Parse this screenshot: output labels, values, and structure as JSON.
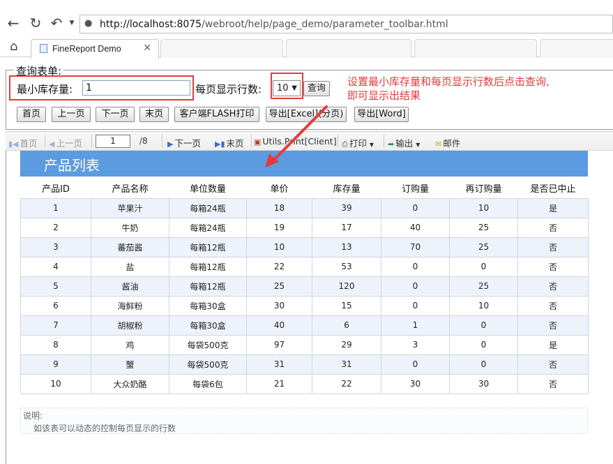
{
  "browser": {
    "url_host": "http://localhost:8075",
    "url_path": "/webroot/help/page_demo/parameter_toolbar.html",
    "tab_title": "FineReport Demo"
  },
  "query_form": {
    "legend": "查询表单:",
    "min_stock_label": "最小库存量:",
    "min_stock_value": "1",
    "rows_label": "每页显示行数:",
    "rows_value": "10",
    "query_button": "查询",
    "buttons": [
      "首页",
      "上一页",
      "下一页",
      "末页",
      "客户端FLASH打印",
      "导出[Excel](分页)",
      "导出[Word]"
    ]
  },
  "annotation": {
    "line1": "设置最小库存量和每页显示行数后点击查询,",
    "line2": "即可显示出结果"
  },
  "toolbar": {
    "first": "首页",
    "prev": "上一页",
    "page_current": "1",
    "page_total": "/8",
    "next": "下一页",
    "last": "末页",
    "print_client": "Utils.Print[Client]",
    "print": "打印",
    "export": "输出",
    "email": "邮件"
  },
  "report": {
    "title": "产品列表",
    "columns": [
      "产品ID",
      "产品名称",
      "单位数量",
      "单价",
      "库存量",
      "订购量",
      "再订购量",
      "是否已中止"
    ],
    "rows": [
      [
        "1",
        "苹果汁",
        "每箱24瓶",
        "18",
        "39",
        "0",
        "10",
        "是"
      ],
      [
        "2",
        "牛奶",
        "每箱24瓶",
        "19",
        "17",
        "40",
        "25",
        "否"
      ],
      [
        "3",
        "蕃茄酱",
        "每箱12瓶",
        "10",
        "13",
        "70",
        "25",
        "否"
      ],
      [
        "4",
        "盐",
        "每箱12瓶",
        "22",
        "53",
        "0",
        "0",
        "否"
      ],
      [
        "5",
        "酱油",
        "每箱12瓶",
        "25",
        "120",
        "0",
        "25",
        "否"
      ],
      [
        "6",
        "海鲜粉",
        "每箱30盒",
        "30",
        "15",
        "0",
        "10",
        "否"
      ],
      [
        "7",
        "胡椒粉",
        "每箱30盒",
        "40",
        "6",
        "1",
        "0",
        "否"
      ],
      [
        "8",
        "鸡",
        "每袋500克",
        "97",
        "29",
        "3",
        "0",
        "是"
      ],
      [
        "9",
        "蟹",
        "每袋500克",
        "31",
        "31",
        "0",
        "0",
        "否"
      ],
      [
        "10",
        "大众奶酪",
        "每袋6包",
        "21",
        "22",
        "30",
        "30",
        "否"
      ]
    ]
  },
  "note": {
    "title": "说明:",
    "text": "如该表可以动态的控制每页显示的行数"
  }
}
